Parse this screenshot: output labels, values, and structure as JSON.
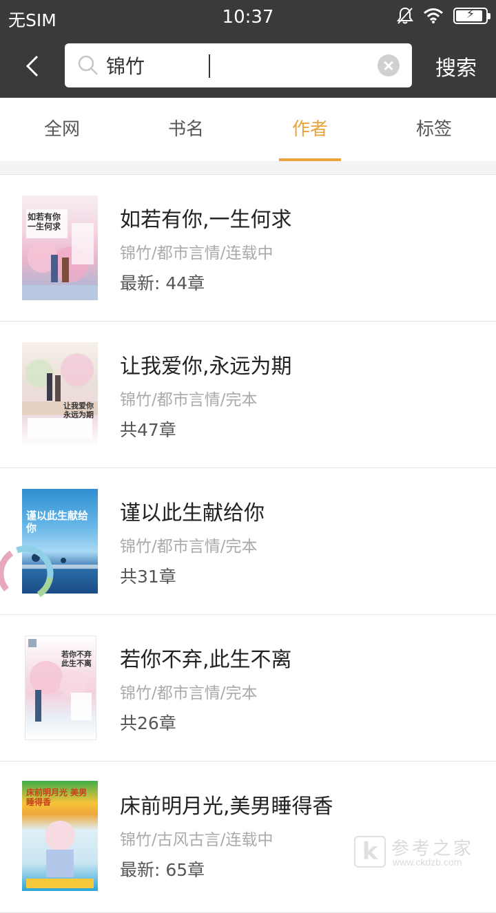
{
  "status_bar": {
    "carrier": "无SIM",
    "time": "10:37",
    "battery_level": 0.9
  },
  "search": {
    "query": "锦竹",
    "submit_label": "搜索"
  },
  "tabs": [
    {
      "label": "全网",
      "active": false
    },
    {
      "label": "书名",
      "active": false
    },
    {
      "label": "作者",
      "active": true
    },
    {
      "label": "标签",
      "active": false
    }
  ],
  "books": [
    {
      "title": "如若有你,一生何求",
      "meta": "锦竹/都市言情/连载中",
      "latest": "最新: 44章",
      "cover_text": "如若有你 一生何求"
    },
    {
      "title": "让我爱你,永远为期",
      "meta": "锦竹/都市言情/完本",
      "latest": "共47章",
      "cover_text": "让我爱你 永远为期"
    },
    {
      "title": "谨以此生献给你",
      "meta": "锦竹/都市言情/完本",
      "latest": "共31章",
      "cover_text": "谨以此生献给你"
    },
    {
      "title": "若你不弃,此生不离",
      "meta": "锦竹/都市言情/完本",
      "latest": "共26章",
      "cover_text": "若你不弃 此生不离"
    },
    {
      "title": "床前明月光,美男睡得香",
      "meta": "锦竹/古风古言/连载中",
      "latest": "最新: 65章",
      "cover_text": "床前明月光 美男睡得香"
    }
  ],
  "watermark": {
    "logo_letter": "k",
    "text": "参考之家",
    "url": "www.ckdzb.com"
  },
  "colors": {
    "accent": "#e8a33b",
    "header_bg": "#3a3a3a",
    "divider": "#e4e4e4"
  }
}
